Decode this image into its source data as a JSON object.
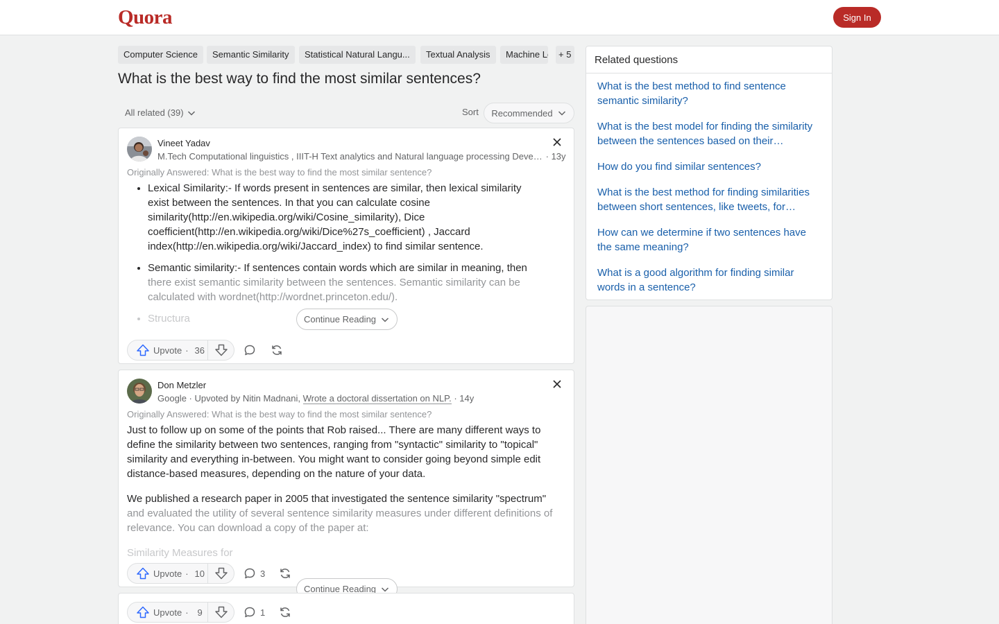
{
  "header": {
    "logo": "Quora",
    "signin_label": "Sign In"
  },
  "topics": [
    "Computer Science",
    "Semantic Similarity",
    "Statistical Natural Langu...",
    "Textual Analysis",
    "Machine Learning"
  ],
  "topics_more": "+ 5",
  "question": {
    "title": "What is the best way to find the most similar sentences?"
  },
  "filter": {
    "all_related": "All related (39)",
    "sort_label": "Sort",
    "sort_value": "Recommended"
  },
  "answers": [
    {
      "author": "Vineet Yadav",
      "credential": "M.Tech Computational linguistics , IIIT-H Text analytics and Natural language processing Developer",
      "time": "· 13y",
      "originally": "Originally Answered: What is the best way to find the most similar sentence?",
      "items": [
        "Lexical Similarity:- If words present in sentences are similar, then lexical similarity exist between the sentences. In that you can calculate cosine similarity(http://en.wikipedia.org/wiki/Cosine_similarity), Dice coefficient(http://en.wikipedia.org/wiki/Dice%27s_coefficient) , Jaccard index(http://en.wikipedia.org/wiki/Jaccard_index) to find similar sentence.",
        "Semantic similarity:- If sentences contain words which are similar in meaning, then",
        "there exist semantic similarity between the sentences. Semantic similarity can be calculated with wordnet(http://wordnet.princeton.edu/).",
        "Structura"
      ],
      "continue": "Continue Reading",
      "upvote": "Upvote",
      "upvote_count": "36"
    },
    {
      "author": "Don Metzler",
      "credential_prefix": "Google · Upvoted by Nitin Madnani,",
      "credential_link": "Wrote a doctoral dissertation on NLP.",
      "time": "· 14y",
      "originally": "Originally Answered: What is the best way to find the most similar sentence?",
      "p1": "Just to follow up on some of the points that Rob raised... There are many different ways to define the similarity between two sentences, ranging from \"syntactic\" similarity to \"topical\" similarity and everything in-between. You might want to consider going beyond simple edit distance-based measures, depending on the nature of your data.",
      "p2a": "We published a research paper in 2005 that investigated the sentence similarity \"spectrum\"",
      "p2b": "and evaluated the utility of several sentence similarity measures under different definitions of relevance. You can download a copy of the paper at:",
      "p3": "Similarity Measures for",
      "continue": "Continue Reading",
      "upvote": "Upvote",
      "upvote_count": "10",
      "comment_count": "3"
    },
    {
      "upvote": "Upvote",
      "upvote_count": "9",
      "comment_count": "1"
    }
  ],
  "related": {
    "title": "Related questions",
    "items": [
      "What is the best method to find sentence semantic similarity?",
      "What is the best model for finding the similarity between the sentences based on their meaning?",
      "How do you find similar sentences?",
      "What is the best method for finding similarities between short sentences, like tweets, for clustering?",
      "How can we determine if two sentences have the same meaning?",
      "What is a good algorithm for finding similar words in a sentence?"
    ]
  },
  "colors": {
    "brand": "#b92b27",
    "link": "#195faa",
    "upvote": "#2e69ff"
  },
  "icons": [
    "chevron-down-icon",
    "close-icon",
    "upvote-icon",
    "downvote-icon",
    "comment-icon",
    "share-icon"
  ]
}
